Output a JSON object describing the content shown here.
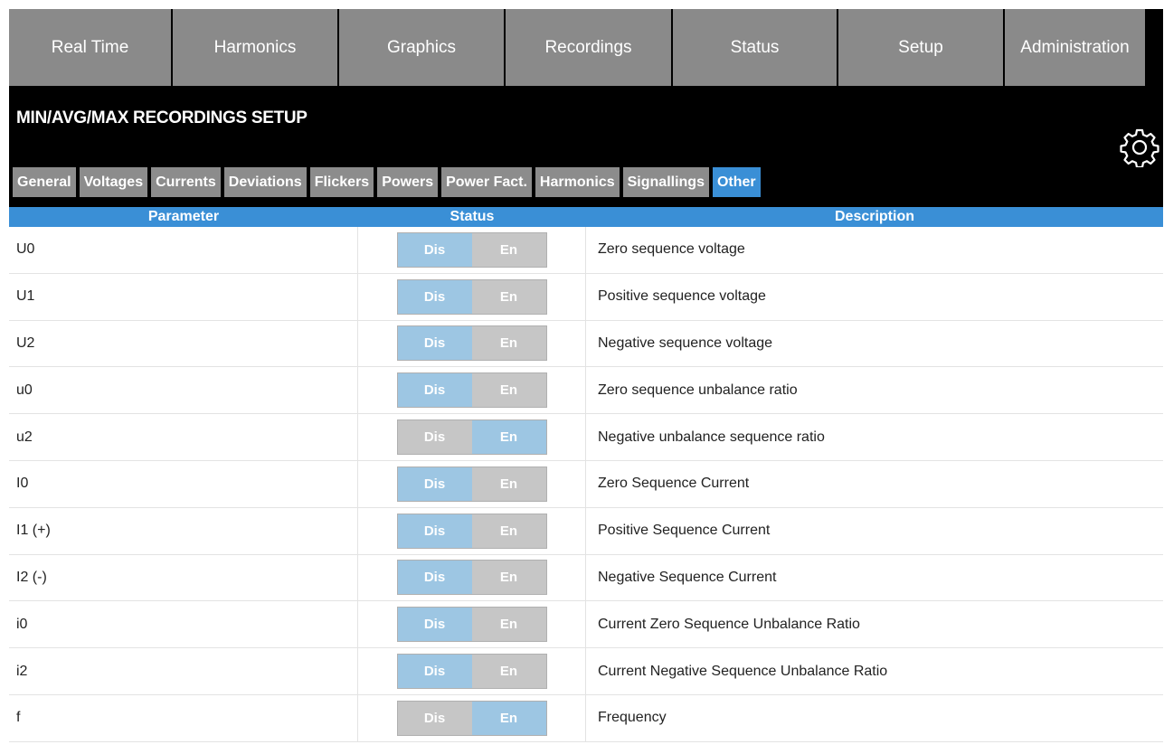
{
  "nav": {
    "tabs": [
      "Real Time",
      "Harmonics",
      "Graphics",
      "Recordings",
      "Status",
      "Setup",
      "Administration"
    ]
  },
  "header": {
    "title": "MIN/AVG/MAX RECORDINGS SETUP",
    "settings_icon": "gear-icon"
  },
  "subtabs": {
    "items": [
      "General",
      "Voltages",
      "Currents",
      "Deviations",
      "Flickers",
      "Powers",
      "Power Fact.",
      "Harmonics",
      "Signallings",
      "Other"
    ],
    "active": "Other"
  },
  "table": {
    "columns": {
      "parameter": "Parameter",
      "status": "Status",
      "description": "Description"
    },
    "toggle_labels": {
      "dis": "Dis",
      "en": "En"
    },
    "rows": [
      {
        "param": "U0",
        "desc": "Zero sequence voltage",
        "selected": "Dis"
      },
      {
        "param": "U1",
        "desc": "Positive sequence voltage",
        "selected": "Dis"
      },
      {
        "param": "U2",
        "desc": "Negative sequence voltage",
        "selected": "Dis"
      },
      {
        "param": "u0",
        "desc": "Zero sequence unbalance ratio",
        "selected": "Dis"
      },
      {
        "param": "u2",
        "desc": "Negative unbalance sequence ratio",
        "selected": "En"
      },
      {
        "param": "I0",
        "desc": "Zero Sequence Current",
        "selected": "Dis"
      },
      {
        "param": "I1 (+)",
        "desc": "Positive Sequence Current",
        "selected": "Dis"
      },
      {
        "param": "I2 (-)",
        "desc": "Negative Sequence Current",
        "selected": "Dis"
      },
      {
        "param": "i0",
        "desc": "Current Zero Sequence Unbalance Ratio",
        "selected": "Dis"
      },
      {
        "param": "i2",
        "desc": "Current Negative Sequence Unbalance Ratio",
        "selected": "Dis"
      },
      {
        "param": "f",
        "desc": "Frequency",
        "selected": "En"
      }
    ]
  },
  "colors": {
    "accent": "#3a8fd6",
    "tab_bg": "#8a8a8a",
    "toggle_on": "#9dc6e3",
    "toggle_off": "#c6c6c6"
  }
}
